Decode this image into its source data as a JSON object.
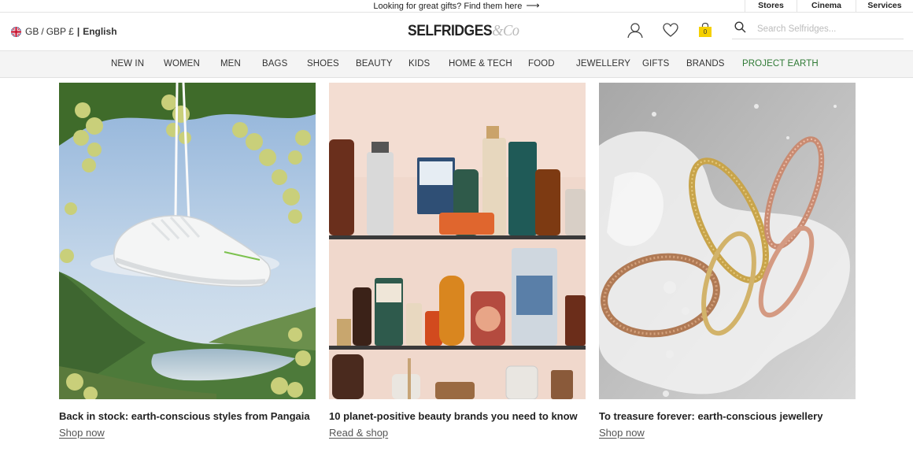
{
  "promo": {
    "text": "Looking for great gifts? Find them here",
    "arrow": "⟶"
  },
  "utility_links": [
    "Stores",
    "Cinema",
    "Services"
  ],
  "locale": {
    "country": "GB",
    "currency": "GBP £",
    "separator": "|",
    "language": "English"
  },
  "brand": {
    "name": "SELFRIDGES",
    "suffix": "&Co"
  },
  "header_icons": [
    "account-icon",
    "wishlist-heart-icon",
    "shopping-bag-icon"
  ],
  "bag": {
    "count": "0",
    "color": "#f5d000"
  },
  "search": {
    "placeholder": "Search Selfridges..."
  },
  "nav": {
    "items": [
      "NEW IN",
      "WOMEN",
      "MEN",
      "BAGS",
      "SHOES",
      "BEAUTY",
      "KIDS",
      "HOME & TECH",
      "FOOD",
      "JEWELLERY",
      "GIFTS",
      "BRANDS",
      "PROJECT EARTH"
    ],
    "highlight_color": "#2f7a35"
  },
  "cards": [
    {
      "title": "Back in stock: earth-conscious styles from Pangaia",
      "cta": "Shop now"
    },
    {
      "title": "10 planet-positive beauty brands you need to know",
      "cta": "Read & shop"
    },
    {
      "title": "To treasure forever: earth-conscious jewellery",
      "cta": "Shop now"
    }
  ]
}
